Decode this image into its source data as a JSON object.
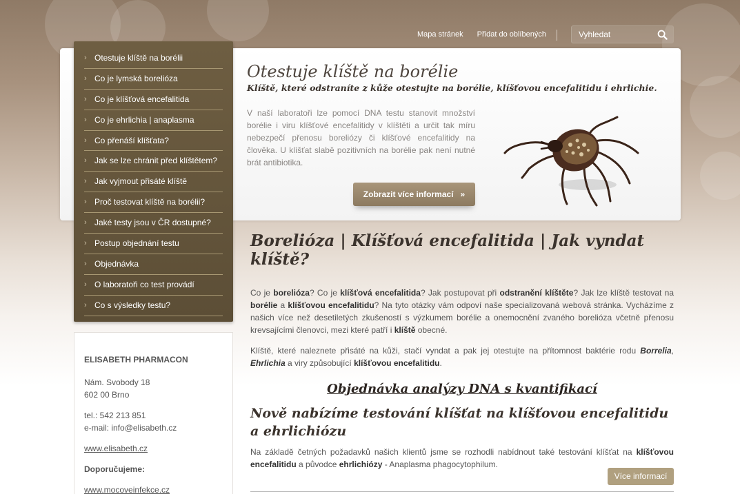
{
  "topnav": {
    "sitemap": "Mapa stránek",
    "favorites": "Přidat do oblíbených"
  },
  "search": {
    "placeholder": "Vyhledat"
  },
  "hero": {
    "title": "Otestuje klíště na borélie",
    "subtitle": "Klíště, které odstraníte z kůže otestujte na borélie, klíšťovou encefalitidu i ehrlichie.",
    "text": "V naší laboratoři lze pomocí DNA testu stanovit množství borélie i viru klíšťové encefalitidy v klíštěti a určit tak míru nebezpečí přenosu boreliózy či klíšťové encefalitidy na člověka. U klíšťat slabě pozitivních na borélie pak není nutné brát antibiotika.",
    "button": "Zobrazit více informací",
    "button_arrow": "»"
  },
  "menu": {
    "chevron": "›",
    "items": [
      "Otestuje klíště na borélii",
      "Co je lymská borelióza",
      "Co je klíšťová encefalitida",
      "Co je ehrlichia | anaplasma",
      "Co přenáší klíšťata?",
      "Jak se lze chránit před klíštětem?",
      "Jak vyjmout přisáté klíště",
      "Proč testovat klíště na borélii?",
      "Jaké testy jsou v ČR dostupné?",
      "Postup objednání testu",
      "Objednávka",
      "O laboratoři co test provádí",
      "Co s výsledky testu?"
    ]
  },
  "contact": {
    "company": "ELISABETH PHARMACON",
    "street": "Nám. Svobody 18",
    "city": "602 00 Brno",
    "phone": "tel.: 542 213 851",
    "email": "e-mail: info@elisabeth.cz",
    "web": "www.elisabeth.cz",
    "recommend_label": "Doporučujeme:",
    "recommend_link": "www.mocoveinfekce.cz"
  },
  "main": {
    "heading": "Borelióza | Klíšťová encefalitida | Jak vyndat klíště?",
    "p1": [
      {
        "t": "Co je ",
        "b": false
      },
      {
        "t": "borelióza",
        "b": true
      },
      {
        "t": "? Co je ",
        "b": false
      },
      {
        "t": "klíšťová encefalitida",
        "b": true
      },
      {
        "t": "? Jak postupovat při ",
        "b": false
      },
      {
        "t": "odstranění klíštěte",
        "b": true
      },
      {
        "t": "? Jak lze klíště testovat na ",
        "b": false
      },
      {
        "t": "borélie",
        "b": true
      },
      {
        "t": " a ",
        "b": false
      },
      {
        "t": "klíšťovou encefalitidu",
        "b": true
      },
      {
        "t": "? Na tyto otázky vám odpoví naše specializovaná webová stránka. Vycházíme z našich více než desetiletých zkušeností s výzkumem borélie a onemocnění zvaného borelióza včetně přenosu krevsajícími členovci, mezi které patří i ",
        "b": false
      },
      {
        "t": "klíště",
        "b": true
      },
      {
        "t": " obecné.",
        "b": false
      }
    ],
    "p2": [
      {
        "t": "Klíště, které naleznete přisáté na kůži, stačí vyndat a pak jej otestujte na přítomnost baktérie rodu ",
        "b": false
      },
      {
        "t": "Borrelia",
        "b": true,
        "i": true
      },
      {
        "t": ", ",
        "b": false
      },
      {
        "t": "Ehrlichia",
        "b": true,
        "i": true
      },
      {
        "t": " a viry způsobující ",
        "b": false
      },
      {
        "t": "klíšťovou encefalitidu",
        "b": true
      },
      {
        "t": ".",
        "b": false
      }
    ],
    "order_link": "Objednávka analýzy DNA s kvantifikací",
    "h2": "Nově nabízíme testování klíšťat na klíšťovou encefalitidu a ehrlichiózu",
    "p3": [
      {
        "t": "Na základě četných požadavků našich klientů jsme se rozhodli nabídnout také testování klíšťat na ",
        "b": false
      },
      {
        "t": "klíšťovou encefalitidu",
        "b": true
      },
      {
        "t": " a původce ",
        "b": false
      },
      {
        "t": "ehrlichiózy",
        "b": true
      },
      {
        "t": " - Anaplasma phagocytophilum.",
        "b": false
      }
    ],
    "more_button": "Více informací"
  },
  "colors": {
    "menu_bg": "#5c4e36",
    "button": "#8c7a60",
    "heading": "#3b332d"
  },
  "icons": {
    "search": "search-icon",
    "tick": "tick-image",
    "chevron": "chevron-right-icon"
  }
}
